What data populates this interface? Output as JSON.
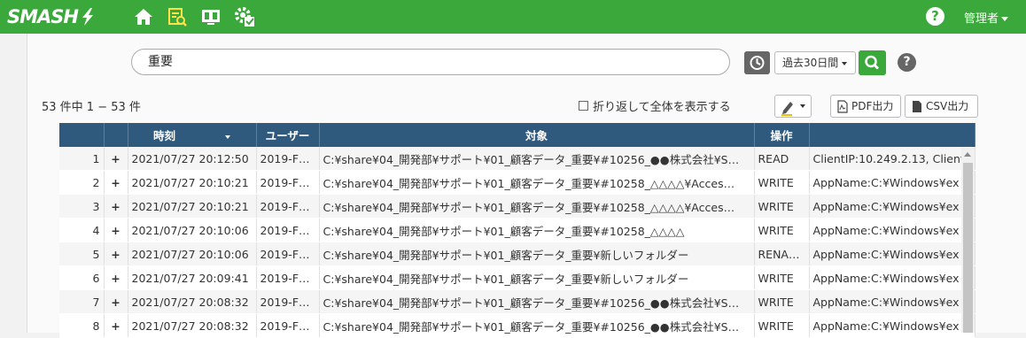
{
  "header": {
    "logo": "SMASH",
    "help_label": "?",
    "user_label": "管理者"
  },
  "toolbar": {
    "search_value": "重要",
    "period_label": "過去30日間",
    "help_label": "?"
  },
  "results": {
    "count_text": "53 件中 1 − 53 件",
    "wrap_label": "折り返して全体を表示する",
    "pdf_label": "PDF出力",
    "csv_label": "CSV出力"
  },
  "table": {
    "columns": [
      "",
      "",
      "時刻",
      "ユーザー",
      "対象",
      "操作",
      ""
    ],
    "rows": [
      {
        "n": "1",
        "plus": "+",
        "time": "2021/07/27 20:12:50",
        "user": "2019-F…",
        "target": "C:¥share¥04_開発部¥サポート¥01_顧客データ_重要¥#10256_●●株式会社¥S…",
        "op": "READ",
        "detail": "ClientIP:10.249.2.13, Client"
      },
      {
        "n": "2",
        "plus": "+",
        "time": "2021/07/27 20:10:21",
        "user": "2019-F…",
        "target": "C:¥share¥04_開発部¥サポート¥01_顧客データ_重要¥#10258_△△△△¥Acces…",
        "op": "WRITE",
        "detail": "AppName:C:¥Windows¥ex"
      },
      {
        "n": "3",
        "plus": "+",
        "time": "2021/07/27 20:10:21",
        "user": "2019-F…",
        "target": "C:¥share¥04_開発部¥サポート¥01_顧客データ_重要¥#10258_△△△△¥Acces…",
        "op": "WRITE",
        "detail": "AppName:C:¥Windows¥ex"
      },
      {
        "n": "4",
        "plus": "+",
        "time": "2021/07/27 20:10:06",
        "user": "2019-F…",
        "target": "C:¥share¥04_開発部¥サポート¥01_顧客データ_重要¥#10258_△△△△",
        "op": "WRITE",
        "detail": "AppName:C:¥Windows¥ex"
      },
      {
        "n": "5",
        "plus": "+",
        "time": "2021/07/27 20:10:06",
        "user": "2019-F…",
        "target": "C:¥share¥04_開発部¥サポート¥01_顧客データ_重要¥新しいフォルダー",
        "op": "RENAME",
        "detail": "AppName:C:¥Windows¥ex"
      },
      {
        "n": "6",
        "plus": "+",
        "time": "2021/07/27 20:09:41",
        "user": "2019-F…",
        "target": "C:¥share¥04_開発部¥サポート¥01_顧客データ_重要¥新しいフォルダー",
        "op": "WRITE",
        "detail": "AppName:C:¥Windows¥ex"
      },
      {
        "n": "7",
        "plus": "+",
        "time": "2021/07/27 20:08:32",
        "user": "2019-F…",
        "target": "C:¥share¥04_開発部¥サポート¥01_顧客データ_重要¥#10256_●●株式会社¥S…",
        "op": "WRITE",
        "detail": "AppName:C:¥Windows¥ex"
      },
      {
        "n": "8",
        "plus": "+",
        "time": "2021/07/27 20:08:32",
        "user": "2019-F…",
        "target": "C:¥share¥04_開発部¥サポート¥01_顧客データ_重要¥#10256_●●株式会社¥S…",
        "op": "WRITE",
        "detail": "AppName:C:¥Windows¥ex"
      }
    ]
  },
  "colors": {
    "topbar": "#3aa83a",
    "table_header": "#2f5a7e"
  },
  "icons": [
    "home-icon",
    "search-log-icon",
    "monitor-icon",
    "settings-check-icon",
    "clock-icon",
    "search-icon",
    "pen-icon",
    "pdf-icon",
    "csv-icon"
  ]
}
